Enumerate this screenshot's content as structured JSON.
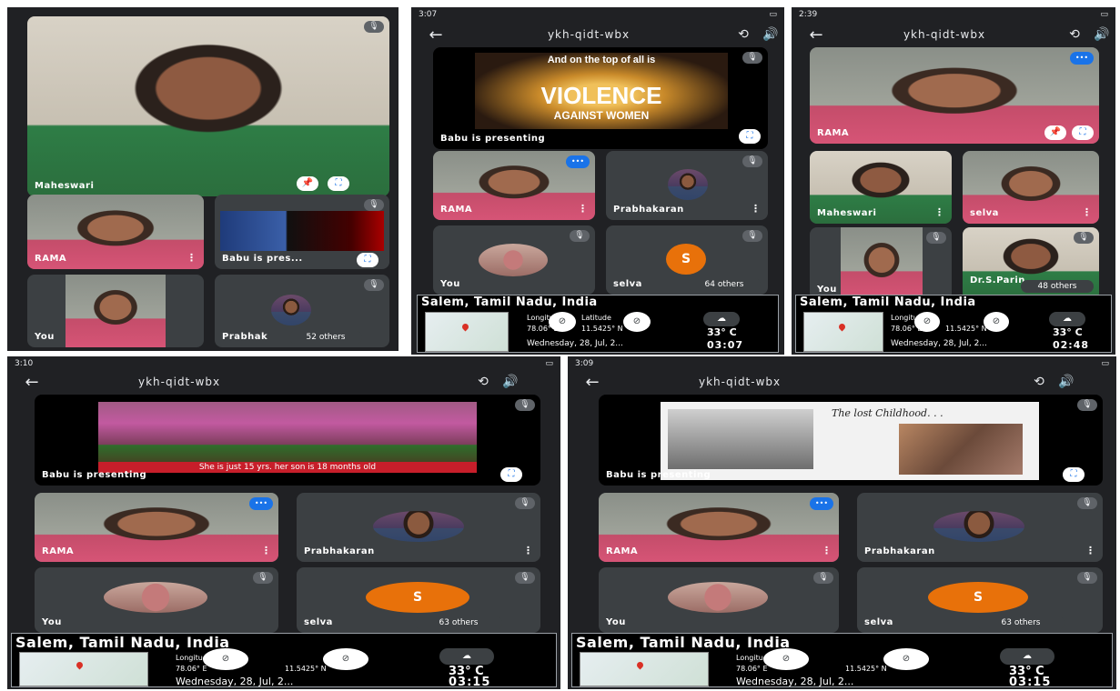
{
  "meeting": {
    "code": "ykh-qidt-wbx"
  },
  "presenter_text": "Babu is presenting",
  "presenter_short": "Babu is pres...",
  "location": {
    "city": "Salem, Tamil Nadu, India",
    "longitude_label": "Longitude",
    "latitude_label": "Latitude",
    "longitude": "78.06° E",
    "latitude": "11.5425° N",
    "temperature": "33° C",
    "date": "Wednesday, 28, Jul, 2..."
  },
  "panels": [
    {
      "status_time": "",
      "main_name": "Maheswari",
      "tiles": [
        "RAMA",
        "Babu is pres...",
        "You",
        "Prabhak"
      ],
      "others": "52 others"
    },
    {
      "status_time": "3:07",
      "slide_heading": "And on the top of all is",
      "slide_title": "VIOLENCE",
      "slide_sub": "AGAINST WOMEN",
      "tiles": [
        "RAMA",
        "Prabhakaran",
        "You",
        "selva"
      ],
      "others": "64 others",
      "clock": "03:07"
    },
    {
      "status_time": "2:39",
      "main_name": "RAMA",
      "tiles": [
        "Maheswari",
        "selva",
        "You",
        "Dr.S.Parin"
      ],
      "others": "48 others",
      "clock": "02:48"
    },
    {
      "status_time": "3:10",
      "slide_caption": "She is just 15 yrs. her son is 18 months old",
      "tiles": [
        "RAMA",
        "Prabhakaran",
        "You",
        "selva"
      ],
      "others": "63 others",
      "clock": "03:15"
    },
    {
      "status_time": "3:09",
      "slide_title": "The lost Childhood. . .",
      "tiles": [
        "RAMA",
        "Prabhakaran",
        "You",
        "selva"
      ],
      "others": "63 others",
      "clock": "03:15"
    }
  ],
  "avatar_letter": "S",
  "colors": {
    "meet_bg": "#202124",
    "tile_bg": "#3c4043",
    "accent": "#1a73e8",
    "avatar_orange": "#e8710a"
  },
  "icons": [
    "back-arrow-icon",
    "switch-camera-icon",
    "speaker-icon",
    "mic-off-icon",
    "pin-icon",
    "fullscreen-icon",
    "more-vert-icon",
    "speaking-indicator-icon",
    "weather-icon",
    "map-pin-icon"
  ]
}
